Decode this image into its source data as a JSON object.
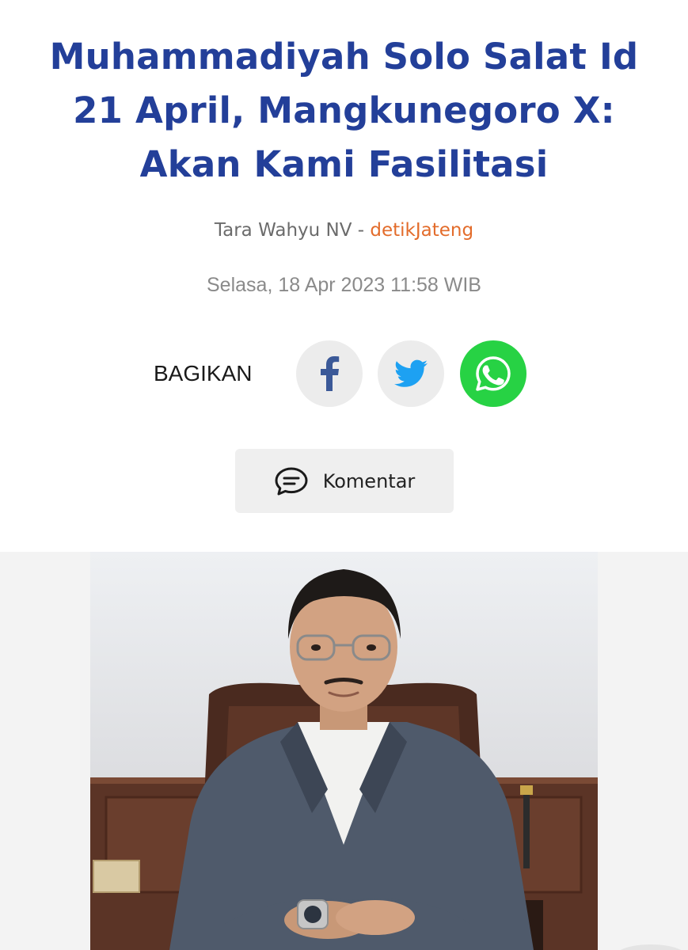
{
  "article": {
    "headline_lines": [
      "Muhammadiyah Solo Salat Id",
      "21 April, Mangkunegoro X:",
      "Akan Kami Fasilitasi"
    ],
    "author": "Tara Wahyu NV",
    "separator": " - ",
    "source": "detikJateng",
    "date": "Selasa, 18 Apr 2023 11:58 WIB"
  },
  "share": {
    "label": "BAGIKAN",
    "buttons": [
      {
        "name": "facebook",
        "icon": "facebook-icon",
        "color": "#3b5998"
      },
      {
        "name": "twitter",
        "icon": "twitter-icon",
        "color": "#1da1f2"
      },
      {
        "name": "whatsapp",
        "icon": "whatsapp-icon",
        "color": "#27d244"
      }
    ]
  },
  "comment": {
    "label": "Komentar",
    "icon": "speech-bubble-icon"
  },
  "colors": {
    "headline": "#233f99",
    "source": "#e36c2b",
    "whatsapp": "#27d244"
  }
}
